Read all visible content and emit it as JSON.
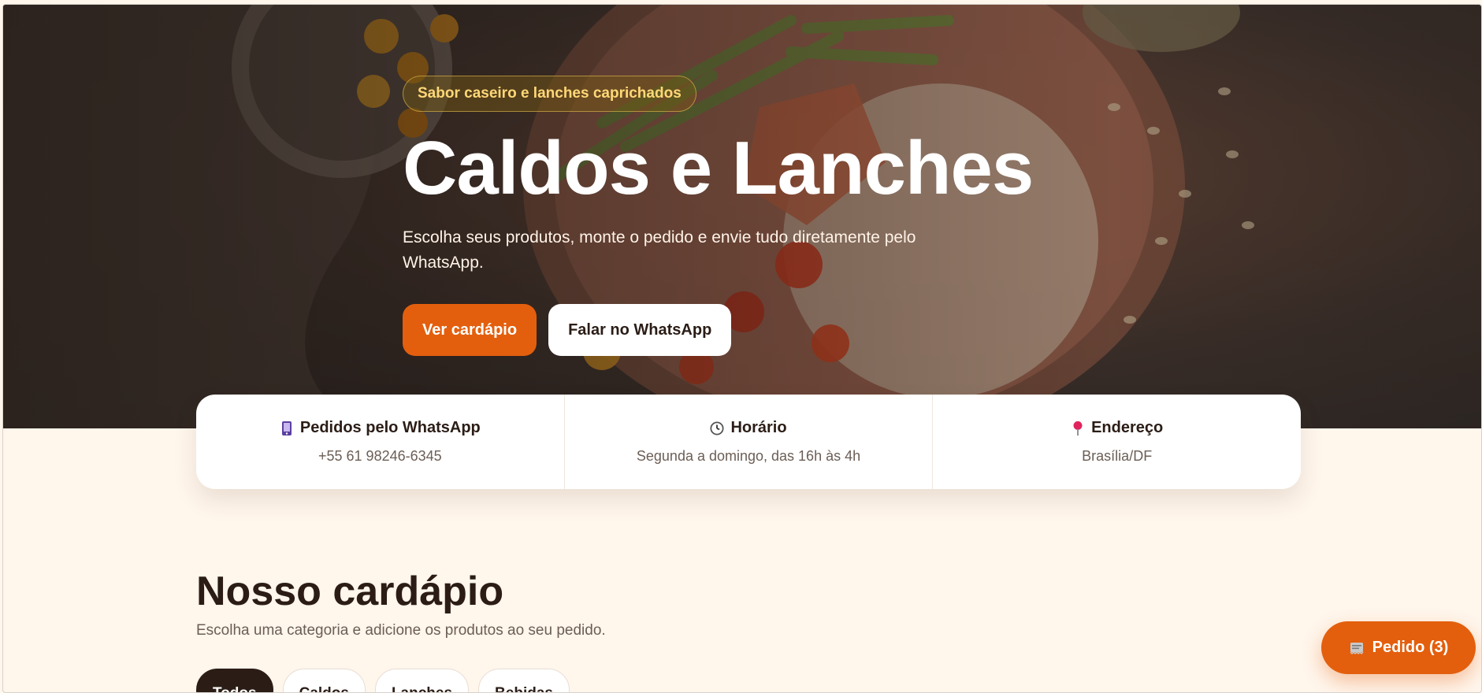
{
  "hero": {
    "tagline": "Sabor caseiro e lanches caprichados",
    "title": "Caldos e Lanches",
    "subtitle": "Escolha seus produtos, monte o pedido e envie tudo diretamente pelo WhatsApp.",
    "primary_button": "Ver cardápio",
    "secondary_button": "Falar no WhatsApp"
  },
  "info": [
    {
      "icon": "phone-icon",
      "title": "Pedidos pelo WhatsApp",
      "value": "+55 61 98246-6345"
    },
    {
      "icon": "clock-icon",
      "title": "Horário",
      "value": "Segunda a domingo, das 16h às 4h"
    },
    {
      "icon": "pin-icon",
      "title": "Endereço",
      "value": "Brasília/DF"
    }
  ],
  "menu": {
    "title": "Nosso cardápio",
    "subtitle": "Escolha uma categoria e adicione os produtos ao seu pedido.",
    "filters": [
      "Todos",
      "Caldos",
      "Lanches",
      "Bebidas"
    ],
    "active_filter": "Todos"
  },
  "order_button": {
    "label": "Pedido (3)",
    "icon": "receipt-icon"
  },
  "colors": {
    "accent": "#e35f0d",
    "dark": "#2b1d16",
    "page_bg": "#fff6ec",
    "tagline_text": "#ffd877"
  }
}
